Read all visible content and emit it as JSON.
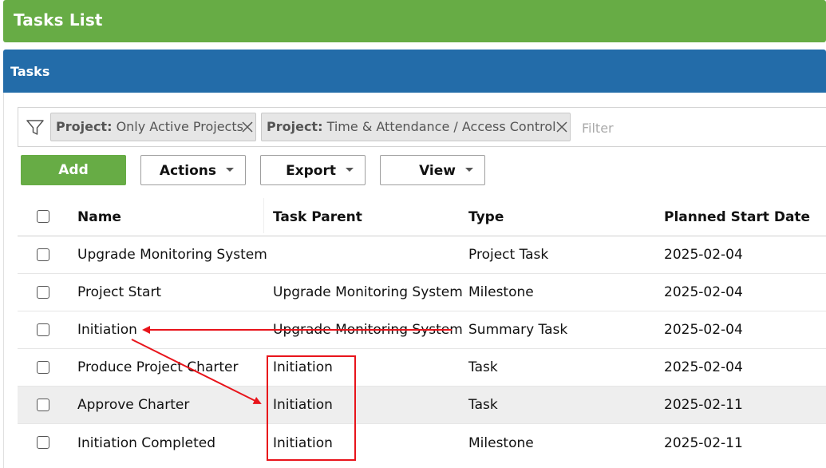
{
  "title": "Tasks  List",
  "panel": {
    "title": "Tasks"
  },
  "filters": {
    "chips": [
      {
        "key": "Project:",
        "value": " Only Active Projects"
      },
      {
        "key": "Project:",
        "value": " Time & Attendance / Access Control"
      }
    ],
    "placeholder": "Filter",
    "icon": "filter-icon"
  },
  "toolbar": {
    "add_label": "Add",
    "actions_label": "Actions",
    "export_label": "Export",
    "view_label": "View"
  },
  "table": {
    "columns": [
      "Name",
      "Task Parent",
      "Type",
      "Planned Start Date"
    ],
    "rows": [
      {
        "name": "Upgrade Monitoring System",
        "parent": "",
        "type": "Project Task",
        "start": "2025-02-04"
      },
      {
        "name": "Project Start",
        "parent": "Upgrade Monitoring System",
        "type": "Milestone",
        "start": "2025-02-04"
      },
      {
        "name": "Initiation",
        "parent": "Upgrade Monitoring System",
        "type": "Summary Task",
        "start": "2025-02-04"
      },
      {
        "name": "Produce Project Charter",
        "parent": "Initiation",
        "type": "Task",
        "start": "2025-02-04"
      },
      {
        "name": "Approve Charter",
        "parent": "Initiation",
        "type": "Task",
        "start": "2025-02-11"
      },
      {
        "name": "Initiation Completed",
        "parent": "Initiation",
        "type": "Milestone",
        "start": "2025-02-11"
      }
    ]
  },
  "annotation_color": "#e8141b"
}
